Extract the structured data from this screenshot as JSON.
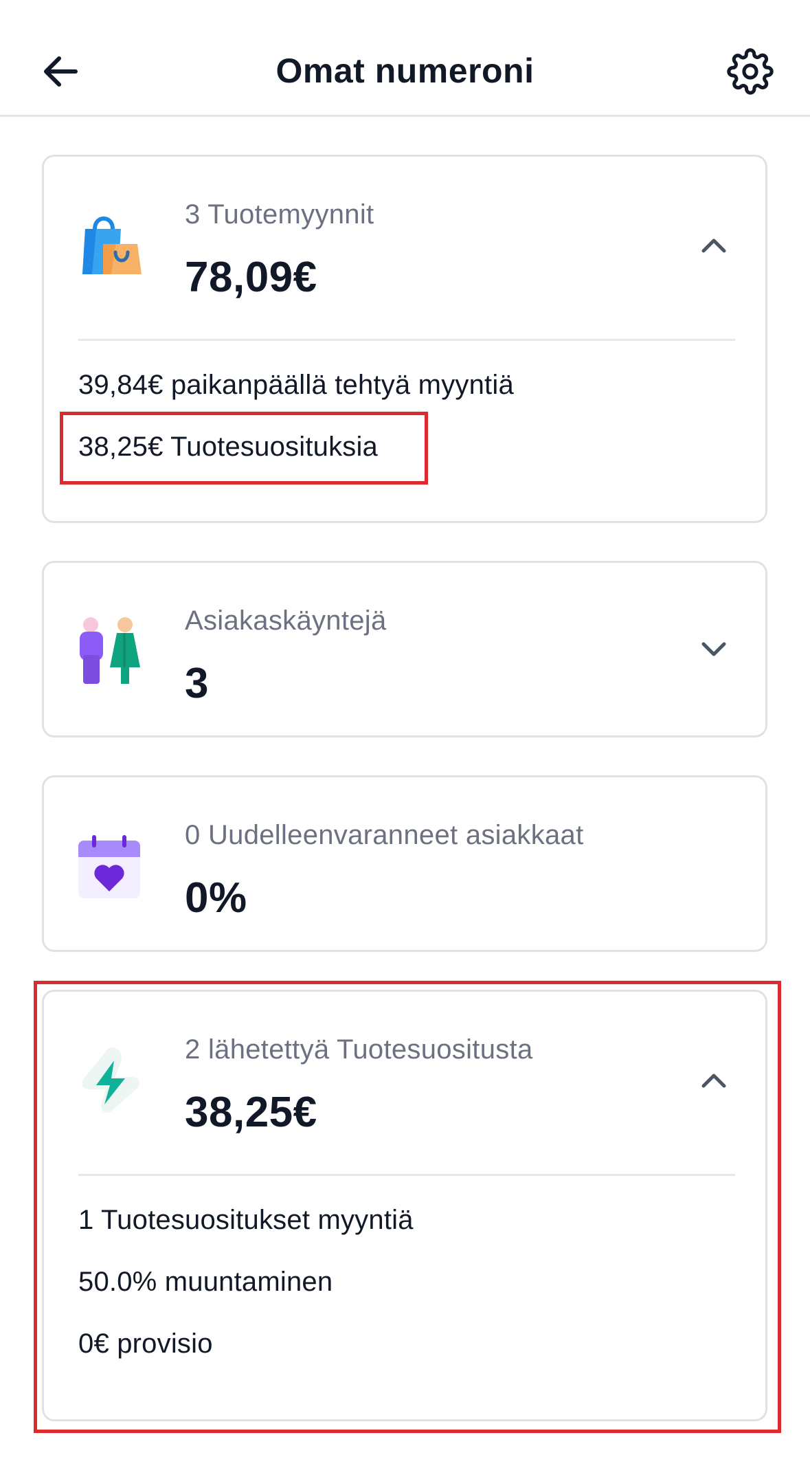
{
  "header": {
    "title": "Omat numeroni",
    "back_icon": "arrow-left-icon",
    "settings_icon": "gear-icon"
  },
  "cards": [
    {
      "id": "product-sales",
      "icon": "shopping-bags-icon",
      "caption": "3 Tuotemyynnit",
      "value": "78,09€",
      "expanded": true,
      "details": [
        "39,84€ paikanpäällä tehtyä myyntiä",
        "38,25€ Tuotesuosituksia"
      ]
    },
    {
      "id": "customer-visits",
      "icon": "people-icon",
      "caption": "Asiakaskäyntejä",
      "value": "3",
      "expanded": false
    },
    {
      "id": "rebooked-customers",
      "icon": "calendar-heart-icon",
      "caption": "0 Uudelleenvaranneet asiakkaat",
      "value": "0%"
    },
    {
      "id": "sent-recommendations",
      "icon": "lightning-icon",
      "caption": "2 lähetettyä Tuotesuositusta",
      "value": "38,25€",
      "expanded": true,
      "details": [
        "1 Tuotesuositukset myyntiä",
        "50.0% muuntaminen",
        "0€ provisio"
      ]
    }
  ],
  "colors": {
    "highlight": "#dc2a2f",
    "text_primary": "#111827",
    "text_secondary": "#6b7180",
    "border": "#e0e1e5"
  }
}
